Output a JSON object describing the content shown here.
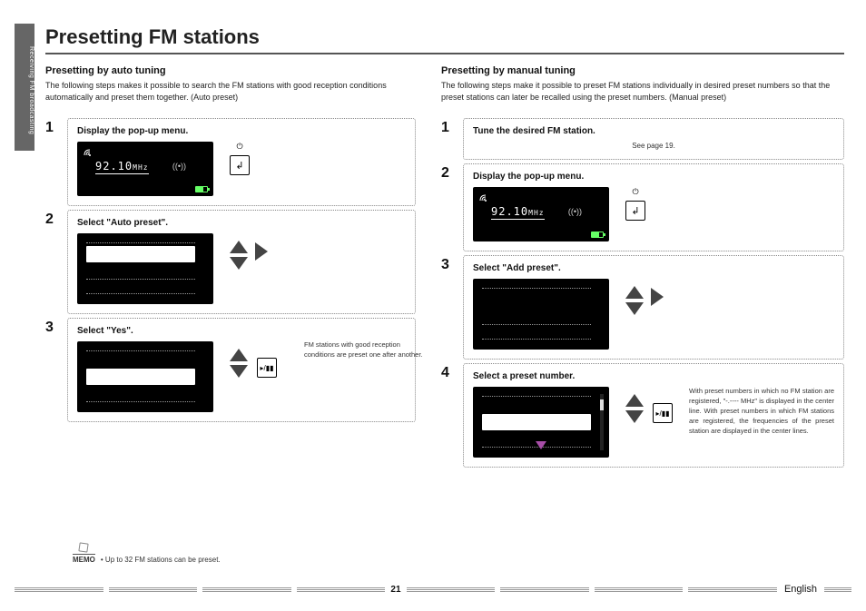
{
  "side_tab": "Receiving FM broadcasting",
  "title": "Presetting FM stations",
  "left": {
    "subhead": "Presetting by auto tuning",
    "intro": "The following steps makes it possible to search the FM stations with good reception conditions automatically and preset them together. (Auto preset)",
    "steps": [
      {
        "num": "1",
        "title": "Display the pop-up menu."
      },
      {
        "num": "2",
        "title": "Select \"Auto preset\"."
      },
      {
        "num": "3",
        "title": "Select \"Yes\".",
        "note": "FM stations with good reception conditions are preset one after another."
      }
    ]
  },
  "right": {
    "subhead": "Presetting by manual tuning",
    "intro": "The following steps make it possible to preset FM stations individually in desired preset numbers so that the preset stations can later be recalled using the preset numbers. (Manual preset)",
    "steps": [
      {
        "num": "1",
        "title": "Tune the desired FM station.",
        "see": "See page 19."
      },
      {
        "num": "2",
        "title": "Display the pop-up menu."
      },
      {
        "num": "3",
        "title": "Select \"Add preset\"."
      },
      {
        "num": "4",
        "title": "Select a preset number.",
        "note": "With preset numbers in which no FM station are registered, \"-.---- MHz\" is displayed in the center line. With preset numbers in which FM stations are registered, the frequencies of the preset station are displayed in the center lines."
      }
    ]
  },
  "screen": {
    "freq_num": "92.10",
    "freq_unit": "MHz"
  },
  "memo": {
    "label": "MEMO",
    "text": "• Up to 32 FM stations can be preset."
  },
  "footer": {
    "page": "21",
    "lang": "English"
  },
  "icons": {
    "power": "⏻",
    "enter": "↲",
    "play": "▸/▮▮"
  }
}
